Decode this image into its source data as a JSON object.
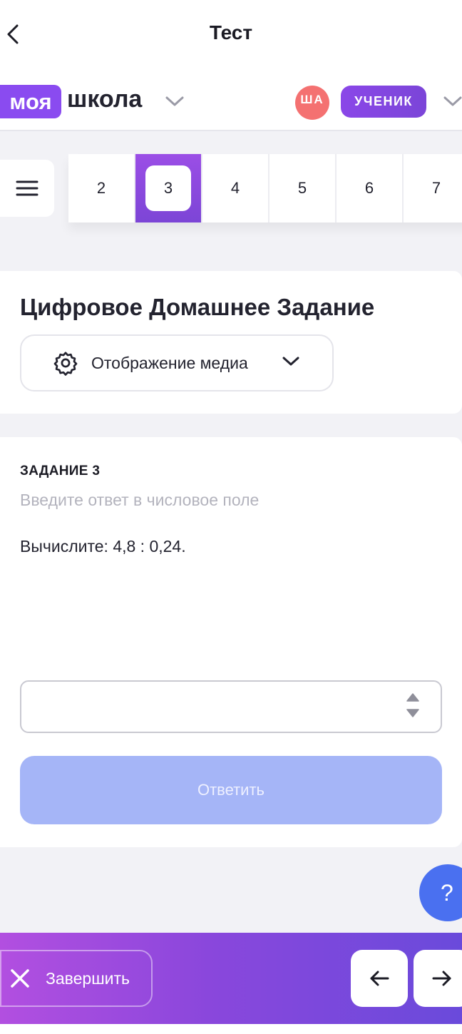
{
  "header": {
    "title": "Тест",
    "back_icon": "chevron-left-icon"
  },
  "brand": {
    "logo_part1": "моя",
    "logo_part2": "школа",
    "logo_color": "#8a4bf0"
  },
  "user": {
    "initials": "ША",
    "avatar_color": "#f47171",
    "role": "УЧЕНИК",
    "role_color": "#8a47e8"
  },
  "tabs": {
    "items": [
      {
        "label": "2"
      },
      {
        "label": "3",
        "active": true
      },
      {
        "label": "4"
      },
      {
        "label": "5"
      },
      {
        "label": "6"
      },
      {
        "label": "7"
      }
    ]
  },
  "homework": {
    "title": "Цифровое Домашнее Задание",
    "media_button": "Отображение медиа"
  },
  "task": {
    "label": "ЗАДАНИЕ 3",
    "hint": "Введите ответ в числовое поле",
    "question": "Вычислите: 4,8 : 0,24.",
    "answer_value": "",
    "submit_label": "Ответить",
    "submit_color": "#a5b5f7"
  },
  "help": {
    "label": "?"
  },
  "bottom": {
    "finish_label": "Завершить",
    "prev_icon": "arrow-left-icon",
    "next_icon": "arrow-right-icon"
  }
}
